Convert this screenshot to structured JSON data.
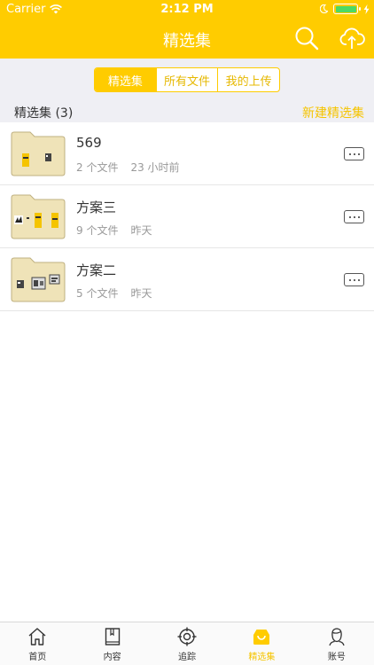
{
  "status_bar": {
    "carrier": "Carrier",
    "time": "2:12 PM"
  },
  "nav": {
    "title": "精选集"
  },
  "segments": [
    {
      "label": "精选集",
      "active": true
    },
    {
      "label": "所有文件",
      "active": false
    },
    {
      "label": "我的上传",
      "active": false
    }
  ],
  "section": {
    "title": "精选集 (3)",
    "new_link": "新建精选集"
  },
  "collections": [
    {
      "name": "569",
      "count": "2 个文件",
      "time": "23 小时前"
    },
    {
      "name": "方案三",
      "count": "9 个文件",
      "time": "昨天"
    },
    {
      "name": "方案二",
      "count": "5 个文件",
      "time": "昨天"
    }
  ],
  "tabs": [
    {
      "label": "首页",
      "icon": "home-icon"
    },
    {
      "label": "内容",
      "icon": "book-icon"
    },
    {
      "label": "追踪",
      "icon": "target-icon"
    },
    {
      "label": "精选集",
      "icon": "collection-icon",
      "active": true
    },
    {
      "label": "账号",
      "icon": "profile-icon"
    }
  ],
  "colors": {
    "accent": "#ffcc00",
    "folder": "#efe3b8"
  }
}
